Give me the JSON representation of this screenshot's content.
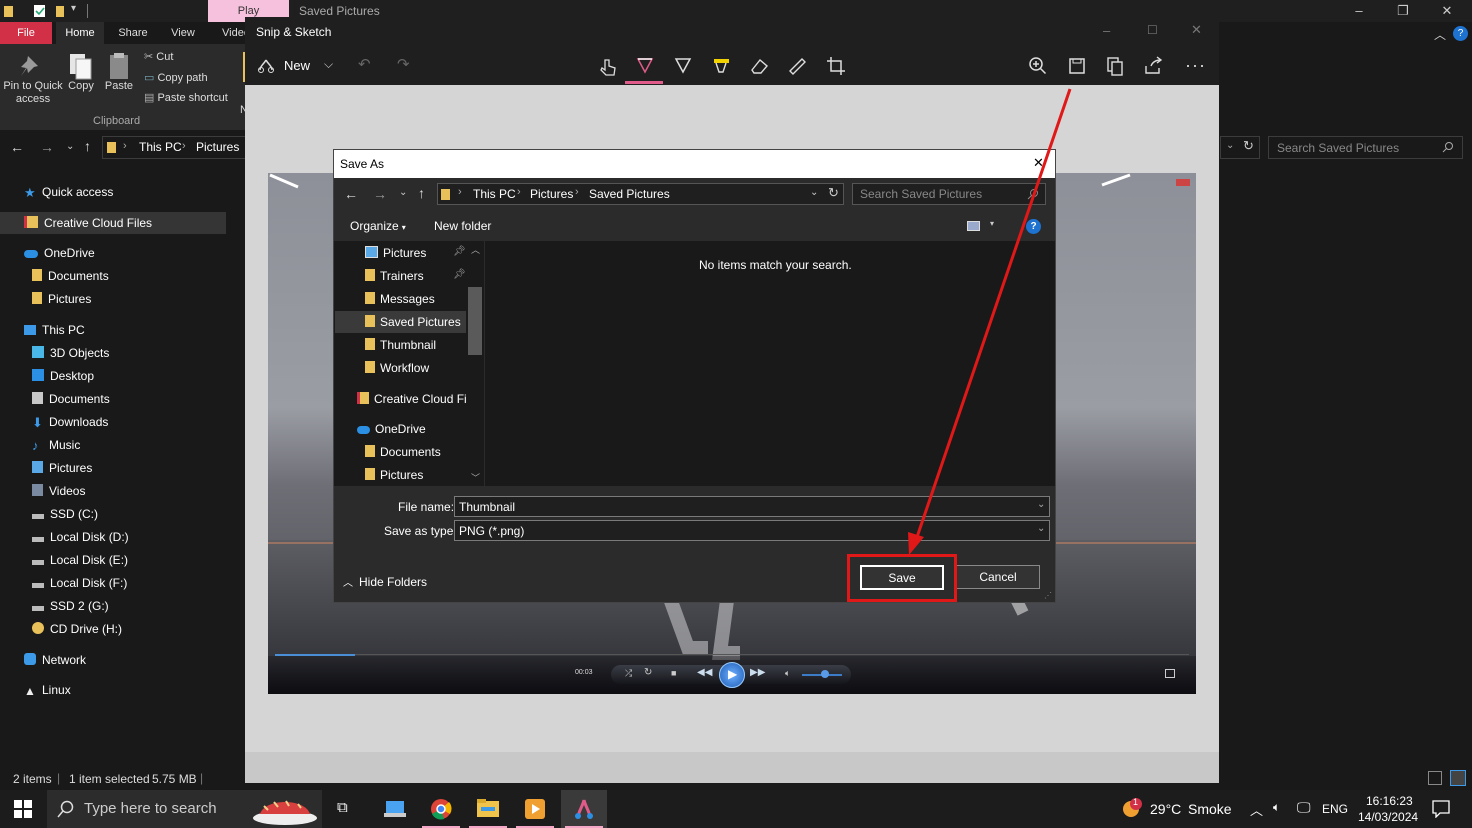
{
  "explorer": {
    "contextual_tab": "Play",
    "title": "Saved Pictures",
    "tabs": [
      "File",
      "Home",
      "Share",
      "View",
      "Video"
    ],
    "ribbon": {
      "pin_label": "Pin to Quick access",
      "pin_line1": "Pin to Quick",
      "pin_line2": "access",
      "copy_label": "Copy",
      "paste_label": "Paste",
      "cut_label": "Cut",
      "copy_path_label": "Copy path",
      "paste_shortcut_label": "Paste shortcut",
      "group_label": "Clipboard",
      "truncated_label": "N"
    },
    "breadcrumb": [
      "This PC",
      "Pictures"
    ],
    "search_placeholder": "Search Saved Pictures",
    "nav": {
      "quick_access": "Quick access",
      "creative_cloud": "Creative Cloud Files",
      "onedrive": "OneDrive",
      "onedrive_children": [
        "Documents",
        "Pictures"
      ],
      "this_pc": "This PC",
      "this_pc_children": [
        "3D Objects",
        "Desktop",
        "Documents",
        "Downloads",
        "Music",
        "Pictures",
        "Videos",
        "SSD (C:)",
        "Local Disk (D:)",
        "Local Disk (E:)",
        "Local Disk (F:)",
        "SSD 2 (G:)",
        "CD Drive (H:)"
      ],
      "network": "Network",
      "linux": "Linux"
    },
    "status": {
      "items": "2 items",
      "selected": "1 item selected",
      "size": "5.75 MB"
    }
  },
  "snip": {
    "title": "Snip & Sketch",
    "new_label": "New",
    "video_time": "00:03"
  },
  "dialog": {
    "title": "Save As",
    "breadcrumb": [
      "This PC",
      "Pictures",
      "Saved Pictures"
    ],
    "search_placeholder": "Search Saved Pictures",
    "organize_label": "Organize",
    "new_folder_label": "New folder",
    "help_label": "?",
    "tree": {
      "pictures": "Pictures",
      "pictures_children": [
        "Trainers",
        "Messages",
        "Saved Pictures",
        "Thumbnail",
        "Workflow"
      ],
      "creative_cloud": "Creative Cloud Files",
      "onedrive": "OneDrive",
      "onedrive_children": [
        "Documents",
        "Pictures"
      ]
    },
    "empty_message": "No items match your search.",
    "file_name_label": "File name:",
    "file_name_value": "Thumbnail",
    "save_type_label": "Save as type:",
    "save_type_value": "PNG (*.png)",
    "hide_folders_label": "Hide Folders",
    "save_label": "Save",
    "cancel_label": "Cancel"
  },
  "taskbar": {
    "search_placeholder": "Type here to search",
    "weather_temp": "29°C",
    "weather_desc": "Smoke",
    "weather_badge": "1",
    "language": "ENG",
    "time": "16:16:23",
    "date": "14/03/2024"
  },
  "colors": {
    "annotation_red": "#e01818",
    "file_tab": "#d23047",
    "play_tab": "#f6c1dc",
    "folder_yellow": "#e8c15a",
    "onedrive_blue": "#2b8fe3"
  }
}
